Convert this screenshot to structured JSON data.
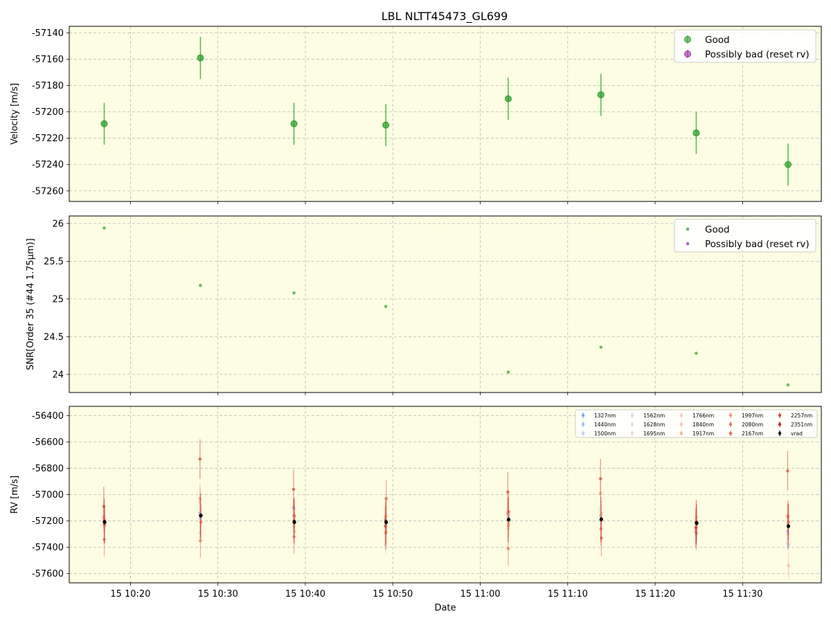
{
  "title": "LBL NLTT45473_GL699",
  "colors": {
    "panel_bg": "#fdfde3",
    "good": "#2ca02c",
    "bad": "#9a2fa0",
    "grid": "#b8b8b8",
    "vrad": "#000000"
  },
  "chart_data": [
    {
      "type": "scatter",
      "panel": "velocity",
      "ylabel": "Velocity [m/s]",
      "ylim": [
        -57268,
        -57135
      ],
      "yticks": [
        -57140,
        -57160,
        -57180,
        -57200,
        -57220,
        -57240,
        -57260
      ],
      "grid": true,
      "legend_position": "top-right",
      "legend": [
        "Good",
        "Possibly bad (reset rv)"
      ],
      "series": [
        {
          "name": "Good",
          "x": [
            "10:17",
            "10:28",
            "10:38.7",
            "10:49.2",
            "11:03.2",
            "11:13.8",
            "11:24.7",
            "11:35.2"
          ],
          "y": [
            -57209,
            -57159,
            -57209,
            -57210,
            -57190,
            -57187,
            -57216,
            -57240
          ],
          "err": [
            16,
            16,
            16,
            16,
            16,
            16,
            16,
            16
          ]
        },
        {
          "name": "Possibly bad (reset rv)",
          "x": [],
          "y": [],
          "err": []
        }
      ]
    },
    {
      "type": "scatter",
      "panel": "snr",
      "ylabel": "SNR[Order 35 (#44 1.75μm)]",
      "ylim": [
        23.76,
        26.1
      ],
      "yticks": [
        24.0,
        24.5,
        25.0,
        25.5,
        26.0
      ],
      "grid": true,
      "legend_position": "top-right",
      "legend": [
        "Good",
        "Possibly bad (reset rv)"
      ],
      "series": [
        {
          "name": "Good",
          "x": [
            "10:17",
            "10:28",
            "10:38.7",
            "10:49.2",
            "11:03.2",
            "11:13.8",
            "11:24.7",
            "11:35.2"
          ],
          "y": [
            25.94,
            25.18,
            25.08,
            24.9,
            24.03,
            24.36,
            24.28,
            23.86
          ]
        },
        {
          "name": "Possibly bad (reset rv)",
          "x": [],
          "y": []
        }
      ]
    },
    {
      "type": "scatter",
      "panel": "rv",
      "ylabel": "RV [m/s]",
      "xlabel": "Date",
      "ylim": [
        -57670,
        -56330
      ],
      "yticks": [
        -56400,
        -56600,
        -56800,
        -57000,
        -57200,
        -57400,
        -57600
      ],
      "xticks": [
        "15 10:20",
        "15 10:30",
        "15 10:40",
        "15 10:50",
        "15 11:00",
        "15 11:10",
        "15 11:20",
        "15 11:30"
      ],
      "grid": true,
      "legend_position": "top-right",
      "legend": [
        "1327nm",
        "1440nm",
        "1500nm",
        "1562nm",
        "1628nm",
        "1695nm",
        "1766nm",
        "1840nm",
        "1917nm",
        "1997nm",
        "2080nm",
        "2167nm",
        "2257nm",
        "2351nm",
        "vrad"
      ],
      "series": [
        {
          "name": "1327nm",
          "color": "#7b9ff9",
          "y": [
            -57170,
            -57140,
            -57100,
            -57190,
            -57150,
            -57160,
            -57280,
            -57280
          ],
          "err": [
            60,
            60,
            60,
            60,
            60,
            60,
            60,
            60
          ]
        },
        {
          "name": "1440nm",
          "color": "#9abbff",
          "y": [
            -57230,
            -57180,
            -57110,
            -57230,
            -57140,
            -57200,
            -57300,
            -57300
          ],
          "err": [
            60,
            60,
            60,
            60,
            60,
            60,
            60,
            60
          ]
        },
        {
          "name": "1500nm",
          "color": "#b9d0f9",
          "y": [
            -57200,
            -57150,
            -57170,
            -57260,
            -57160,
            -57140,
            -57230,
            -57380
          ],
          "err": [
            50,
            50,
            50,
            50,
            50,
            50,
            50,
            50
          ]
        },
        {
          "name": "1562nm",
          "color": "#d5dbe5",
          "y": [
            -57180,
            -57290,
            -57220,
            -57380,
            -57170,
            -57100,
            -57260,
            -57370
          ],
          "err": [
            50,
            50,
            50,
            50,
            50,
            50,
            50,
            50
          ]
        },
        {
          "name": "1628nm",
          "color": "#e4d9d2",
          "y": [
            -57220,
            -57160,
            -57240,
            -57280,
            -57240,
            -57220,
            -57200,
            -57190
          ],
          "err": [
            60,
            60,
            60,
            60,
            60,
            60,
            60,
            60
          ]
        },
        {
          "name": "1695nm",
          "color": "#e5d8d1",
          "y": [
            -57250,
            -57120,
            -57180,
            -57400,
            -57230,
            -57200,
            -57250,
            -57200
          ],
          "err": [
            60,
            60,
            60,
            60,
            60,
            60,
            60,
            60
          ]
        },
        {
          "name": "1766nm",
          "color": "#f2cbb7",
          "y": [
            -57180,
            -57060,
            -57120,
            -57200,
            -57260,
            -57120,
            -57230,
            -57220
          ],
          "err": [
            80,
            80,
            80,
            80,
            80,
            80,
            80,
            80
          ]
        },
        {
          "name": "1840nm",
          "color": "#f6bfa6",
          "y": [
            -57210,
            -57040,
            -57240,
            -57160,
            -57240,
            -57160,
            -57200,
            -57300
          ],
          "err": [
            90,
            90,
            90,
            90,
            90,
            90,
            90,
            90
          ]
        },
        {
          "name": "1917nm",
          "color": "#f7b89c",
          "y": [
            -57190,
            -57200,
            -57280,
            -57280,
            -57220,
            -57140,
            -57170,
            -57540
          ],
          "err": [
            100,
            100,
            100,
            100,
            100,
            100,
            100,
            100
          ]
        },
        {
          "name": "1997nm",
          "color": "#f4987a",
          "y": [
            -57170,
            -57030,
            -57160,
            -57170,
            -57140,
            -56990,
            -57260,
            -57160
          ],
          "err": [
            110,
            110,
            110,
            110,
            110,
            110,
            110,
            110
          ]
        },
        {
          "name": "2080nm",
          "color": "#e7745b",
          "y": [
            -57340,
            -57350,
            -57320,
            -57290,
            -57410,
            -57260,
            -57290,
            -57170
          ],
          "err": [
            130,
            130,
            130,
            130,
            130,
            130,
            130,
            130
          ]
        },
        {
          "name": "2167nm",
          "color": "#e36c55",
          "y": [
            -57230,
            -57210,
            -57160,
            -57030,
            -57130,
            -57330,
            -57210,
            -57210
          ],
          "err": [
            140,
            140,
            140,
            140,
            140,
            140,
            140,
            140
          ]
        },
        {
          "name": "2257nm",
          "color": "#d24b40",
          "y": [
            -57090,
            -56730,
            -56960,
            -57240,
            -56980,
            -56880,
            -57250,
            -56820
          ],
          "err": [
            150,
            150,
            150,
            150,
            150,
            150,
            150,
            150
          ]
        },
        {
          "name": "2351nm",
          "color": "#c0282f",
          "y": [
            -57200,
            -57160,
            -57200,
            -57200,
            -57190,
            -57190,
            -57210,
            -57240
          ],
          "err": [
            170,
            170,
            170,
            170,
            170,
            170,
            170,
            170
          ]
        },
        {
          "name": "vrad",
          "color": "#000000",
          "y": [
            -57209,
            -57159,
            -57209,
            -57210,
            -57190,
            -57187,
            -57216,
            -57240
          ],
          "err": [
            16,
            16,
            16,
            16,
            16,
            16,
            16,
            16
          ]
        }
      ]
    }
  ]
}
